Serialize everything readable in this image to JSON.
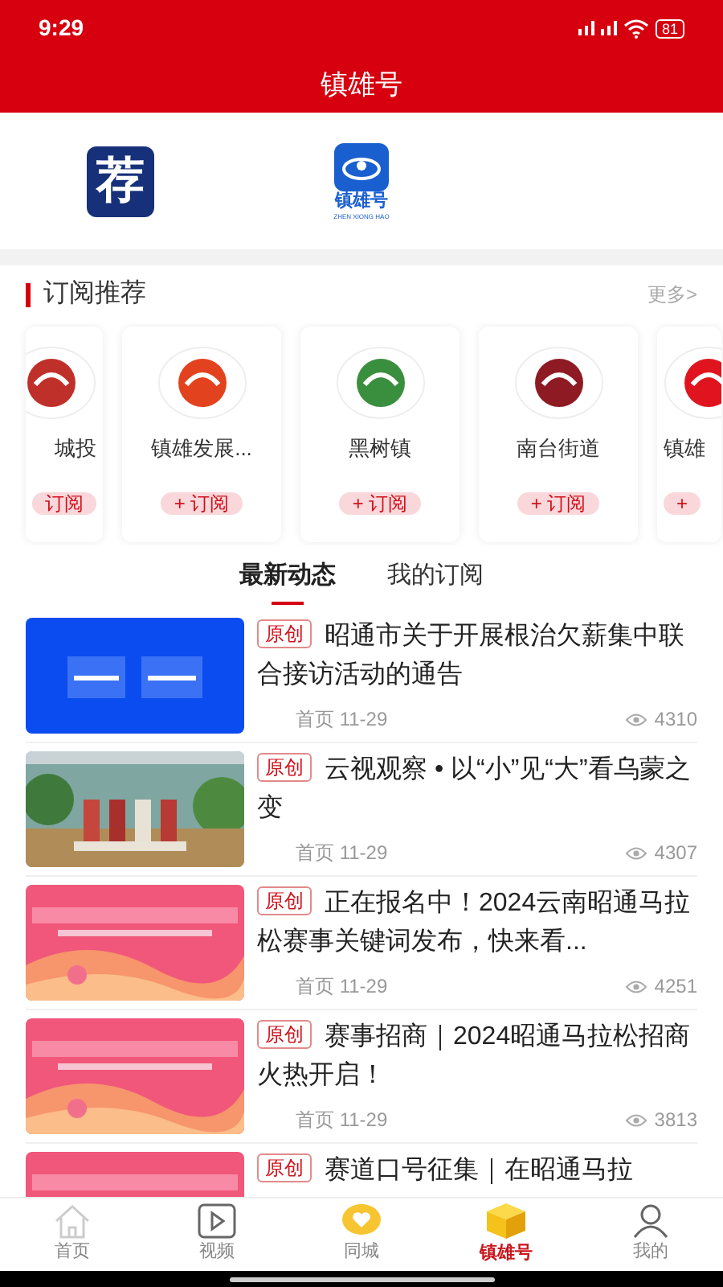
{
  "status_bar": {
    "time": "9:29",
    "battery": "81"
  },
  "header": {
    "title": "镇雄号"
  },
  "shortcuts": [
    {
      "kind": "recommend",
      "glyph": "荐"
    },
    {
      "kind": "brand",
      "caption": "镇雄号",
      "pinyin": "ZHEN XIONG HAO"
    }
  ],
  "subscriptions": {
    "title": "订阅推荐",
    "more": "更多>",
    "cards": [
      {
        "kind": "partial_left",
        "name": "城投",
        "button": "订阅",
        "color": "#c0302a"
      },
      {
        "kind": "full",
        "name": "镇雄发展...",
        "button": "+ 订阅",
        "color": "#e2431e"
      },
      {
        "kind": "full",
        "name": "黑树镇",
        "button": "+ 订阅",
        "color": "#3a8f3e"
      },
      {
        "kind": "full",
        "name": "南台街道",
        "button": "+ 订阅",
        "color": "#8e1b24"
      },
      {
        "kind": "partial_right",
        "name": "镇雄",
        "button": "+",
        "color": "#e0141e"
      }
    ]
  },
  "feed_tabs": [
    {
      "label": "最新动态",
      "selected": true
    },
    {
      "label": "我的订阅",
      "selected": false
    }
  ],
  "articles": [
    {
      "tag": "原创",
      "title": "昭通市关于开展根治欠薪集中联合接访活动的通告",
      "source": "首页",
      "date": "11-29",
      "views": "4310"
    },
    {
      "tag": "原创",
      "title": "云视观察 • 以“小”见“大”看乌蒙之变",
      "source": "首页",
      "date": "11-29",
      "views": "4307"
    },
    {
      "tag": "原创",
      "title": "正在报名中！2024云南昭通马拉松赛事关键词发布，快来看...",
      "source": "首页",
      "date": "11-29",
      "views": "4251"
    },
    {
      "tag": "原创",
      "title": "赛事招商｜2024昭通马拉松招商火热开启！",
      "source": "首页",
      "date": "11-29",
      "views": "3813"
    },
    {
      "tag": "原创",
      "title": "赛道口号征集｜在昭通马拉"
    }
  ],
  "bottom_nav": [
    {
      "label": "首页",
      "selected": false
    },
    {
      "label": "视频",
      "selected": false
    },
    {
      "label": "同城",
      "selected": false
    },
    {
      "label": "镇雄号",
      "selected": true
    },
    {
      "label": "我的",
      "selected": false
    }
  ]
}
